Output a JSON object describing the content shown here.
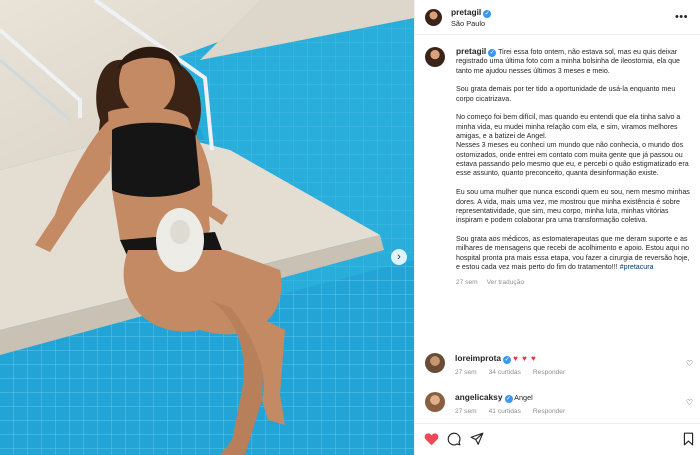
{
  "post": {
    "username": "pretagil",
    "location": "São Paulo",
    "more_label": "•••",
    "next_label": "›",
    "caption": {
      "lead": "Tirei essa foto ontem, não estava sol, mas eu quis deixar registrado uma última foto com a minha bolsinha de ileostomia, ela que tanto me ajudou nesses últimos 3 meses e meio.",
      "p2": "Sou grata demais por ter tido a oportunidade de usá-la enquanto meu corpo cicatrizava.",
      "p3": "No começo foi bem difícil, mas quando eu entendi que ela tinha salvo a minha vida, eu mudei minha relação com ela, e sim, viramos melhores amigas, e a batizei de Angel.",
      "p4": "Nesses 3 meses eu conheci um mundo que não conhecia, o mundo dos ostomizados, onde entrei em contato com muita gente que já passou ou estava passando pelo mesmo que eu, e percebi o quão estigmatizado era esse assunto, quanto preconceito, quanta desinformação existe.",
      "p5": "Eu sou uma mulher que nunca escondi quem eu sou, nem mesmo minhas dores. A vida, mais uma vez, me mostrou que minha existência é sobre representatividade, que sim, meu corpo, minha luta, minhas vitórias inspiram e podem colaborar pra uma transformação coletiva.",
      "p6": "Sou grata aos médicos, as estomaterapeutas que me deram suporte e as milhares de mensagens que recebi de acolhimento e apoio. Estou aqui no hospital pronta pra mais essa etapa, vou fazer a cirurgia de reversão hoje, e estou cada vez mais perto do fim do tratamento!!! ",
      "hashtag": "#pretacura"
    },
    "time": "27 sem",
    "translate_label": "Ver tradução"
  },
  "comments": [
    {
      "username": "loreimprota",
      "verified": true,
      "text": "♥ ♥ ♥",
      "time": "27 sem",
      "likes": "34 curtidas",
      "reply": "Responder"
    },
    {
      "username": "angelicaksy",
      "verified": true,
      "text": "Angel",
      "time": "27 sem",
      "likes": "41 curtidas",
      "reply": "Responder"
    }
  ],
  "icons": [
    "heart-icon",
    "comment-icon",
    "share-icon",
    "bookmark-icon",
    "verified-icon",
    "chevron-right-icon"
  ],
  "colors": {
    "accent": "#3897f0",
    "like": "#ed4956",
    "hashtag": "#00376b",
    "muted": "#8e8e8e",
    "pool": "#23a8d8"
  }
}
